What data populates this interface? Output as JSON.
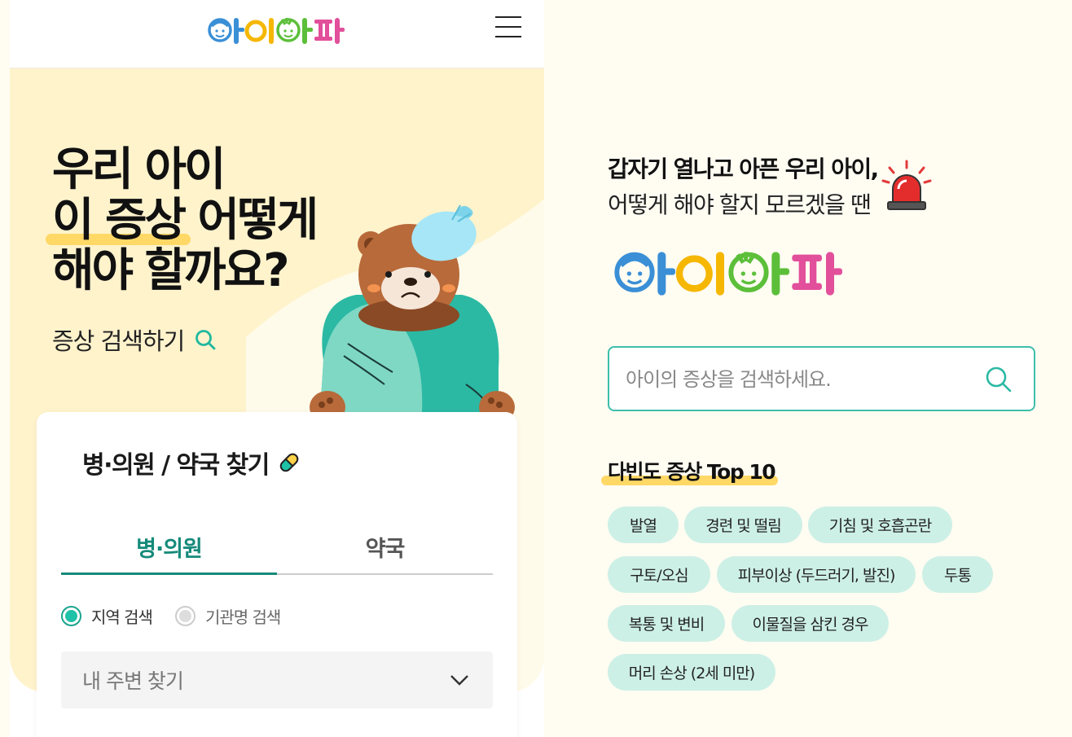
{
  "brand": {
    "logo_text": "아이아파",
    "logo_colors": [
      "#3a8fd6",
      "#f5b700",
      "#5cbf3a",
      "#e24f9a"
    ]
  },
  "mobile": {
    "menu_icon": "hamburger-menu-icon",
    "hero": {
      "title_line1": "우리 아이",
      "title_line2_highlight": "이 증상",
      "title_line2_rest": " 어떻게",
      "title_line3": "해야 할까요?",
      "search_link": "증상 검색하기",
      "search_icon": "search-icon"
    },
    "finder": {
      "title": "병·의원 / 약국 찾기",
      "title_icon": "pill-icon",
      "tabs": [
        {
          "label": "병·의원",
          "active": true
        },
        {
          "label": "약국",
          "active": false
        }
      ],
      "radios": [
        {
          "label": "지역 검색",
          "checked": true
        },
        {
          "label": "기관명 검색",
          "checked": false
        }
      ],
      "select_value": "내 주변 찾기"
    }
  },
  "panel": {
    "intro_bold": "갑자기 열나고 아픈 우리 아이,",
    "intro_normal": "어떻게 해야 할지 모르겠을 땐",
    "siren_icon": "siren-icon",
    "search": {
      "placeholder": "아이의 증상을 검색하세요.",
      "value": ""
    },
    "top10_title": "다빈도 증상 Top 10",
    "symptoms": [
      "발열",
      "경련 및 떨림",
      "기침 및 호흡곤란",
      "구토/오심",
      "피부이상 (두드러기, 발진)",
      "두통",
      "복통 및 변비",
      "이물질을 삼킨 경우",
      "머리 손상 (2세 미만)"
    ]
  },
  "colors": {
    "accent": "#168a7a",
    "hero_bg": "#fff3cc",
    "highlight": "#ffd866",
    "chip_bg": "#cdf0e6"
  }
}
